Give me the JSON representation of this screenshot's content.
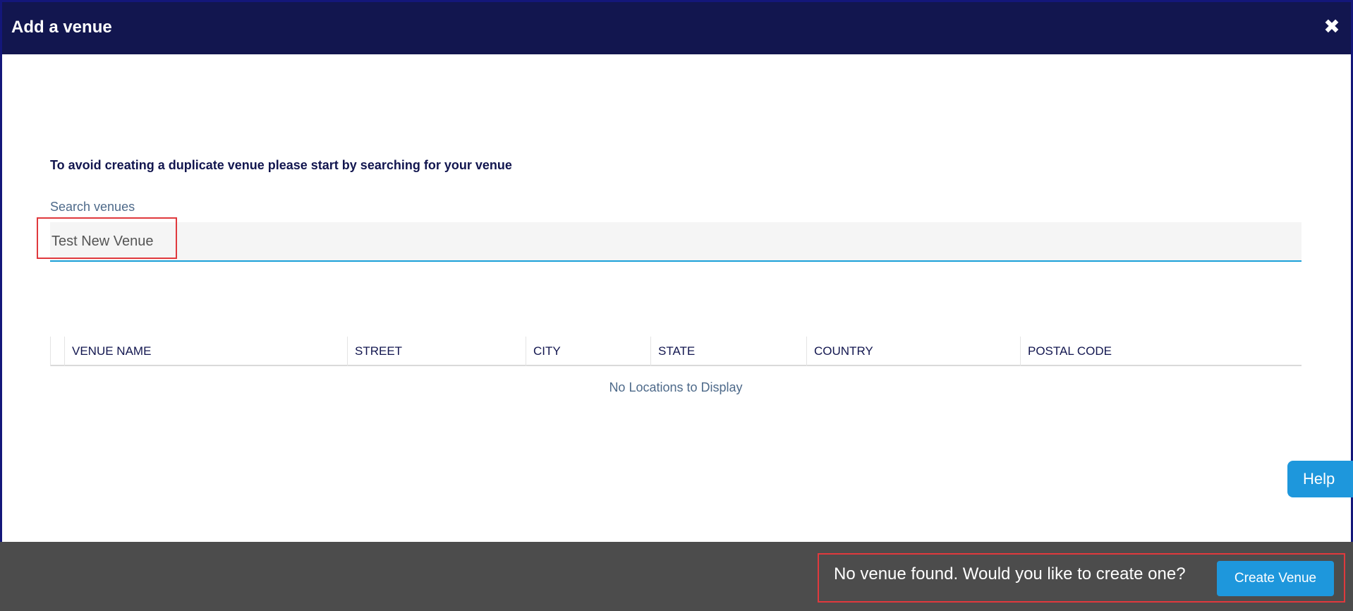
{
  "modal": {
    "title": "Add a venue",
    "close_icon": "close-icon",
    "close_glyph": "✖"
  },
  "intro": "To avoid creating a duplicate venue please start by searching for your venue",
  "search": {
    "label": "Search venues",
    "value": "Test New Venue"
  },
  "table": {
    "columns": [
      "VENUE NAME",
      "STREET",
      "CITY",
      "STATE",
      "COUNTRY",
      "POSTAL CODE"
    ],
    "empty_message": "No Locations to Display"
  },
  "help": {
    "label": "Help"
  },
  "footer": {
    "message": "No venue found. Would you like to create one?",
    "create_label": "Create Venue"
  },
  "colors": {
    "header_bg": "#12164f",
    "accent": "#1e97dc",
    "footer_bg": "#4c4c4c",
    "highlight": "#e0393d"
  }
}
